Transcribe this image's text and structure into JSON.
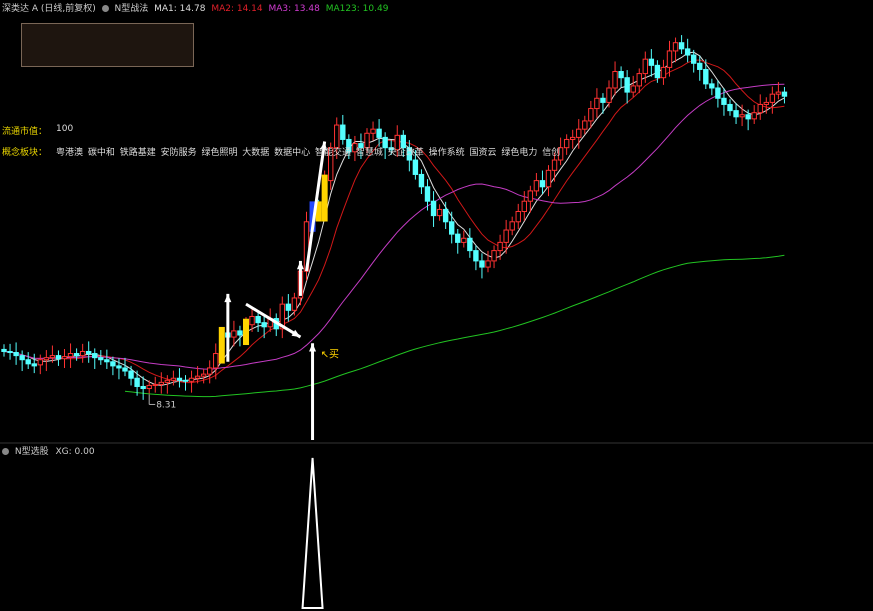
{
  "header": {
    "stock_title": "深类达 A (日线,前复权)",
    "indicator_name": "N型战法",
    "ma1": {
      "label": "MA1: 14.78",
      "color": "#dddddd"
    },
    "ma2": {
      "label": "MA2: 14.14",
      "color": "#e0202a"
    },
    "ma3": {
      "label": "MA3: 13.48",
      "color": "#d23cd2"
    },
    "ma123": {
      "label": "MA123: 10.49",
      "color": "#22c322"
    }
  },
  "info": {
    "market_cap_label": "流通市值：",
    "market_cap_value": "100",
    "concept_label": "概念板块：",
    "concept_value": "粤港澳 碳中和 铁路基建 安防服务 绿色照明 大数据 数据中心 智能交通 智慧城 央企改革 操作系统 国资云 绿色电力 信创"
  },
  "annotations": {
    "low_label": "8.31",
    "buy_label": "买"
  },
  "sub_panel": {
    "name": "N型选股",
    "xg_label": "XG: 0.00"
  },
  "colors": {
    "up": "#ff3232",
    "down": "#54ffff",
    "signal": "#ffd400",
    "blue": "#2448ff",
    "ma1": "#dddddd",
    "ma2": "#d01818",
    "ma3": "#c43cc4",
    "ma123": "#22c322"
  },
  "chart_data": {
    "type": "candlestick",
    "x": [
      "b0",
      "b1",
      "b2",
      "b3",
      "b4",
      "b5",
      "b6",
      "b7",
      "b8",
      "b9",
      "b10",
      "b11",
      "b12",
      "b13",
      "b14",
      "b15",
      "b16",
      "b17",
      "b18",
      "b19",
      "b20",
      "b21",
      "b22",
      "b23",
      "b24",
      "b25",
      "b26",
      "b27",
      "b28",
      "b29",
      "b30",
      "b31",
      "b32",
      "b33",
      "b34",
      "b35",
      "b36",
      "b37",
      "b38",
      "b39",
      "b40",
      "b41",
      "b42",
      "b43",
      "b44",
      "b45",
      "b46",
      "b47",
      "b48",
      "b49",
      "b50",
      "b51",
      "b52",
      "b53",
      "b54",
      "b55",
      "b56",
      "b57",
      "b58",
      "b59",
      "b60",
      "b61",
      "b62",
      "b63",
      "b64",
      "b65",
      "b66",
      "b67",
      "b68",
      "b69",
      "b70",
      "b71",
      "b72",
      "b73",
      "b74",
      "b75",
      "b76",
      "b77",
      "b78",
      "b79",
      "b80",
      "b81",
      "b82",
      "b83",
      "b84",
      "b85",
      "b86",
      "b87",
      "b88",
      "b89",
      "b90",
      "b91",
      "b92",
      "b93",
      "b94",
      "b95",
      "b96",
      "b97",
      "b98",
      "b99",
      "b100",
      "b101",
      "b102",
      "b103",
      "b104",
      "b105",
      "b106",
      "b107",
      "b108",
      "b109",
      "b110",
      "b111",
      "b112",
      "b113",
      "b114",
      "b115",
      "b116",
      "b117",
      "b118",
      "b119",
      "b120",
      "b121",
      "b122",
      "b123",
      "b124",
      "b125",
      "b126",
      "b127",
      "b128",
      "b129",
      "b130",
      "b131",
      "b132",
      "b133",
      "b134",
      "b135",
      "b136",
      "b137",
      "b138",
      "b139",
      "b140",
      "b141",
      "b142",
      "b143"
    ],
    "open": [
      10.4,
      10.3,
      10.25,
      10.1,
      9.9,
      9.7,
      9.65,
      9.9,
      10.0,
      10.1,
      9.95,
      10.05,
      10.2,
      10.1,
      10.3,
      10.2,
      10.0,
      9.9,
      9.8,
      9.6,
      9.5,
      9.35,
      9.0,
      8.6,
      8.5,
      8.65,
      8.7,
      8.8,
      8.9,
      9.0,
      8.9,
      8.85,
      9.0,
      9.1,
      9.2,
      9.5,
      10.2,
      11.2,
      11.0,
      11.3,
      11.1,
      11.6,
      12.0,
      11.7,
      11.5,
      11.9,
      11.4,
      12.6,
      12.3,
      12.9,
      14.2,
      16.6,
      17.3,
      17.1,
      18.6,
      20.2,
      21.3,
      20.6,
      20.0,
      20.4,
      20.2,
      20.9,
      21.1,
      20.7,
      20.2,
      20.1,
      20.8,
      20.2,
      19.6,
      18.9,
      18.3,
      17.6,
      16.9,
      17.2,
      16.6,
      16.0,
      15.6,
      15.8,
      15.2,
      14.7,
      14.4,
      14.7,
      15.2,
      15.6,
      16.2,
      16.6,
      17.1,
      17.6,
      18.1,
      18.6,
      18.3,
      19.1,
      19.6,
      20.2,
      20.6,
      20.7,
      21.1,
      21.5,
      22.1,
      22.6,
      22.4,
      23.1,
      23.9,
      23.6,
      22.9,
      23.2,
      23.8,
      24.5,
      24.2,
      23.6,
      24.1,
      24.9,
      25.3,
      25.0,
      24.7,
      24.3,
      24.0,
      23.3,
      23.1,
      22.6,
      22.3,
      22.0,
      21.7,
      21.8,
      21.6,
      21.9,
      22.3,
      22.4,
      22.8,
      22.9
    ],
    "close": [
      10.3,
      10.25,
      10.1,
      9.9,
      9.7,
      9.6,
      9.9,
      10.0,
      10.1,
      9.95,
      10.05,
      10.2,
      10.1,
      10.3,
      10.2,
      10.0,
      9.9,
      9.8,
      9.6,
      9.5,
      9.35,
      9.0,
      8.6,
      8.5,
      8.65,
      8.7,
      8.8,
      8.9,
      9.0,
      8.9,
      8.85,
      9.0,
      9.1,
      9.2,
      9.5,
      10.2,
      11.2,
      11.0,
      11.3,
      11.1,
      11.6,
      12.0,
      11.7,
      11.5,
      11.9,
      11.4,
      12.6,
      12.3,
      12.9,
      14.2,
      16.6,
      17.3,
      17.1,
      18.6,
      20.2,
      21.3,
      20.6,
      20.0,
      20.4,
      20.2,
      20.9,
      21.1,
      20.7,
      20.2,
      20.1,
      20.8,
      20.2,
      19.6,
      18.9,
      18.3,
      17.6,
      16.9,
      17.2,
      16.6,
      16.0,
      15.6,
      15.8,
      15.2,
      14.7,
      14.4,
      14.7,
      15.2,
      15.6,
      16.2,
      16.6,
      17.1,
      17.6,
      18.1,
      18.6,
      18.3,
      19.1,
      19.6,
      20.2,
      20.6,
      20.7,
      21.1,
      21.5,
      22.1,
      22.6,
      22.4,
      23.1,
      23.9,
      23.6,
      22.9,
      23.2,
      23.8,
      24.5,
      24.2,
      23.6,
      24.1,
      24.9,
      25.3,
      25.0,
      24.7,
      24.3,
      24.0,
      23.3,
      23.1,
      22.6,
      22.3,
      22.0,
      21.7,
      21.8,
      21.6,
      21.9,
      22.3,
      22.4,
      22.8,
      22.9,
      22.7
    ],
    "ylim": [
      6.0,
      26.5
    ],
    "low_marker": 8.31,
    "signal_bars": [
      36,
      40,
      51,
      52,
      53
    ],
    "indicator_xg": {
      "peak_bar": 51,
      "peak": 1.0,
      "current": 0.0,
      "ylim": [
        0,
        1
      ]
    }
  }
}
